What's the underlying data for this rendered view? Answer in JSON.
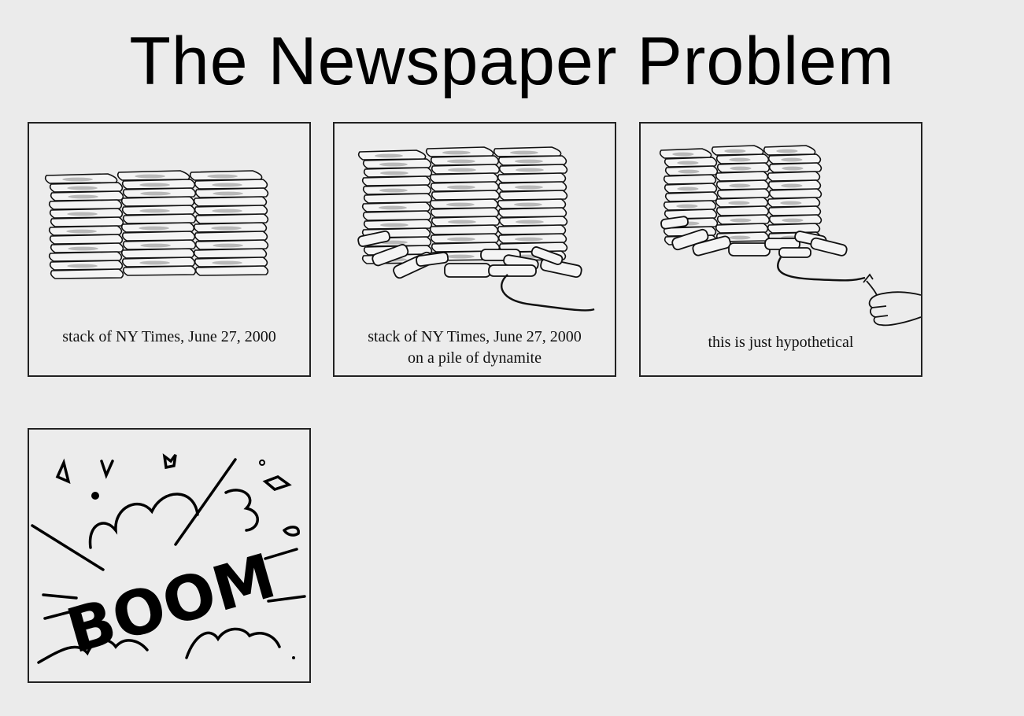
{
  "title": "The Newspaper Problem",
  "panels": [
    {
      "caption_lines": [
        "stack of NY Times, June 27, 2000"
      ]
    },
    {
      "caption_lines": [
        "stack of NY Times, June 27, 2000",
        "on a pile of dynamite"
      ]
    },
    {
      "caption_lines": [
        "this is just hypothetical"
      ]
    },
    {
      "boom_text": "BOOM"
    }
  ]
}
